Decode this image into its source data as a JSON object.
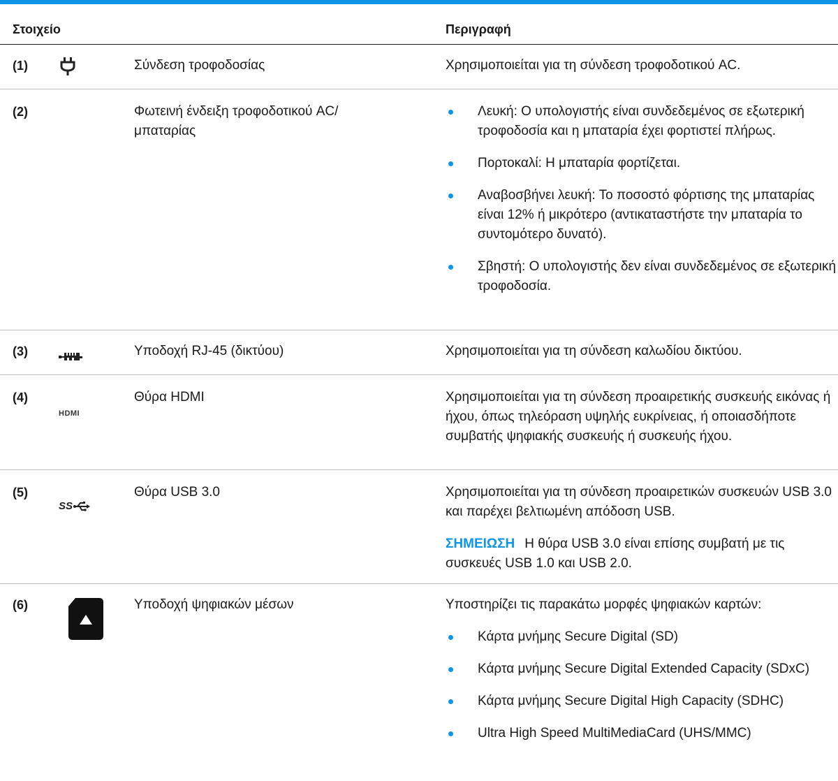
{
  "colors": {
    "accent": "#0d96e8",
    "text": "#1a1a1a"
  },
  "header": {
    "component": "Στοιχείο",
    "description": "Περιγραφή"
  },
  "rows": [
    {
      "num": "(1)",
      "icon": "power-plug-icon",
      "name": "Σύνδεση τροφοδοσίας",
      "desc": "Χρησιμοποιείται για τη σύνδεση τροφοδοτικού AC."
    },
    {
      "num": "(2)",
      "icon": "",
      "name": "Φωτεινή ένδειξη τροφοδοτικού AC/ μπαταρίας",
      "bullets": [
        "Λευκή: Ο υπολογιστής είναι συνδεδεμένος σε εξωτερική τροφοδοσία και η μπαταρία έχει φορτιστεί πλήρως.",
        "Πορτοκαλί: Η μπαταρία φορτίζεται.",
        "Αναβοσβήνει λευκή: Το ποσοστό φόρτισης της μπαταρίας είναι 12% ή μικρότερο (αντικαταστήστε την μπαταρία το συντομότερο δυνατό).",
        "Σβηστή: Ο υπολογιστής δεν είναι συνδεδεμένος σε εξωτερική τροφοδοσία."
      ]
    },
    {
      "num": "(3)",
      "icon": "network-jack-icon",
      "name": "Υποδοχή RJ-45 (δικτύου)",
      "desc": "Χρησιμοποιείται για τη σύνδεση καλωδίου δικτύου."
    },
    {
      "num": "(4)",
      "icon": "hdmi-icon",
      "icon_text": "HDMI",
      "name": "Θύρα HDMI",
      "desc": "Χρησιμοποιείται για τη σύνδεση προαιρετικής συσκευής εικόνας ή ήχου, όπως τηλεόραση υψηλής ευκρίνειας, ή οποιασδήποτε συμβατής ψηφιακής συσκευής ή συσκευής ήχου."
    },
    {
      "num": "(5)",
      "icon": "usb3-icon",
      "icon_text": "SS",
      "name": "Θύρα USB 3.0",
      "desc": "Χρησιμοποιείται για τη σύνδεση προαιρετικών συσκευών USB 3.0 και παρέχει βελτιωμένη απόδοση USB.",
      "note_label": "ΣΗΜΕΙΩΣΗ",
      "note": "Η θύρα USB 3.0 είναι επίσης συμβατή με τις συσκευές USB 1.0 και USB 2.0."
    },
    {
      "num": "(6)",
      "icon": "sd-card-icon",
      "name": "Υποδοχή ψηφιακών μέσων",
      "desc": "Υποστηρίζει τις παρακάτω μορφές ψηφιακών καρτών:",
      "bullets": [
        "Κάρτα μνήμης Secure Digital (SD)",
        "Κάρτα μνήμης Secure Digital Extended Capacity (SDxC)",
        "Κάρτα μνήμης Secure Digital High Capacity (SDHC)",
        "Ultra High Speed MultiMediaCard (UHS/MMC)"
      ]
    }
  ]
}
